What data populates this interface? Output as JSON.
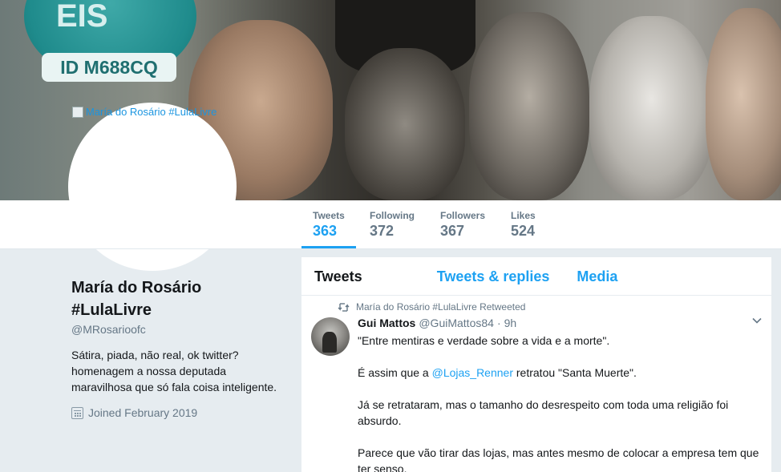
{
  "banner": {
    "badge_text": "ID M688CQ",
    "logo_text": "EIS",
    "broken_image_alt": "María do Rosário #LulaLivre"
  },
  "nav": {
    "stats": [
      {
        "label": "Tweets",
        "value": "363"
      },
      {
        "label": "Following",
        "value": "372"
      },
      {
        "label": "Followers",
        "value": "367"
      },
      {
        "label": "Likes",
        "value": "524"
      }
    ]
  },
  "profile": {
    "name": "María do Rosário #LulaLivre",
    "handle": "@MRosarioofc",
    "bio": "Sátira, piada, não real, ok twitter? homenagem a nossa deputada maravilhosa que só fala coisa inteligente.",
    "joined": "Joined February 2019"
  },
  "timeline": {
    "tabs": [
      "Tweets",
      "Tweets & replies",
      "Media"
    ],
    "tweet": {
      "retweet_context": "María do Rosário #LulaLivre Retweeted",
      "author_name": "Gui Mattos",
      "author_handle": "@GuiMattos84",
      "separator": "·",
      "time": "9h",
      "para1": "\"Entre mentiras e verdade sobre a vida e a morte\".",
      "para2_before": "É assim que a ",
      "para2_mention": "@Lojas_Renner",
      "para2_after": " retratou \"Santa Muerte\".",
      "para3": "Já se retrataram, mas o tamanho do desrespeito com toda uma religião foi absurdo.",
      "para4": "Parece que vão tirar das lojas, mas antes mesmo de colocar a empresa tem que ter senso."
    }
  },
  "colors": {
    "accent": "#1da1f2",
    "secondary_text": "#657786",
    "background": "#e6ecf0"
  }
}
